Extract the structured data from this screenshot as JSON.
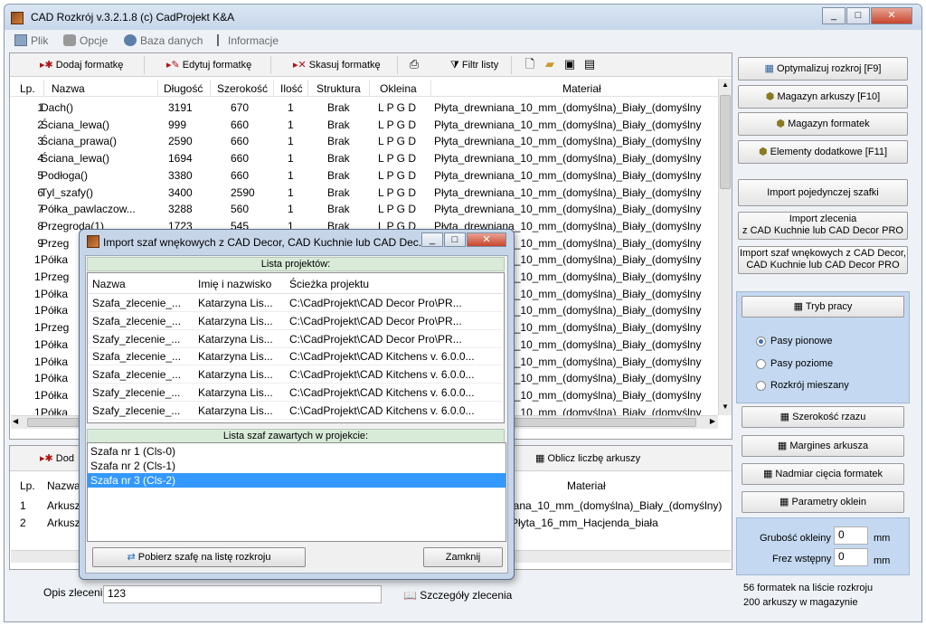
{
  "window": {
    "title": "CAD Rozkrój v.3.2.1.8  (c) CadProjekt K&A",
    "min": "_",
    "max": "□",
    "close": "✕"
  },
  "menu": [
    {
      "label": "Plik",
      "icon": "plik-icon"
    },
    {
      "label": "Opcje",
      "icon": "opcje-icon"
    },
    {
      "label": "Baza danych",
      "icon": "database-icon"
    },
    {
      "label": "Informacje",
      "icon": "info-icon"
    }
  ],
  "toolbar": {
    "add": "Dodaj formatkę",
    "edit": "Edytuj formatkę",
    "delete": "Skasuj formatkę",
    "filter": "Filtr listy"
  },
  "main_table": {
    "headers": [
      "Lp.",
      "Nazwa",
      "Długość",
      "Szerokość",
      "Ilość",
      "Struktura",
      "Okleina",
      "Materiał"
    ],
    "rows": [
      [
        "1",
        "Dach()",
        "3191",
        "670",
        "1",
        "Brak",
        "L P G D",
        "Płyta_drewniana_10_mm_(domyślna)_Biały_(domyślny"
      ],
      [
        "2",
        "Ściana_lewa()",
        "999",
        "660",
        "1",
        "Brak",
        "L P G D",
        "Płyta_drewniana_10_mm_(domyślna)_Biały_(domyślny"
      ],
      [
        "3",
        "Ściana_prawa()",
        "2590",
        "660",
        "1",
        "Brak",
        "L P G D",
        "Płyta_drewniana_10_mm_(domyślna)_Biały_(domyślny"
      ],
      [
        "4",
        "Ściana_lewa()",
        "1694",
        "660",
        "1",
        "Brak",
        "L P G D",
        "Płyta_drewniana_10_mm_(domyślna)_Biały_(domyślny"
      ],
      [
        "5",
        "Podłoga()",
        "3380",
        "660",
        "1",
        "Brak",
        "L P G D",
        "Płyta_drewniana_10_mm_(domyślna)_Biały_(domyślny"
      ],
      [
        "6",
        "Tyl_szafy()",
        "3400",
        "2590",
        "1",
        "Brak",
        "L P G D",
        "Płyta_drewniana_10_mm_(domyślna)_Biały_(domyślny"
      ],
      [
        "7",
        "Półka_pawlaczow...",
        "3288",
        "560",
        "1",
        "Brak",
        "L P G D",
        "Płyta_drewniana_10_mm_(domyślna)_Biały_(domyślny"
      ],
      [
        "8",
        "Przegroda(1)",
        "1723",
        "545",
        "1",
        "Brak",
        "L P G D",
        "Płyta_drewniana_10_mm_(domyślna)_Biały_(domyślny"
      ],
      [
        "9",
        "Przeg",
        "",
        "",
        "",
        "",
        "",
        "Płyta_drewniana_10_mm_(domyślna)_Biały_(domyślny"
      ],
      [
        "1.",
        "Półka",
        "",
        "",
        "",
        "",
        "",
        "Płyta_drewniana_10_mm_(domyślna)_Biały_(domyślny"
      ],
      [
        "1.",
        "Przeg",
        "",
        "",
        "",
        "",
        "",
        "Płyta_drewniana_10_mm_(domyślna)_Biały_(domyślny"
      ],
      [
        "1.",
        "Półka",
        "",
        "",
        "",
        "",
        "",
        "Płyta_drewniana_10_mm_(domyślna)_Biały_(domyślny"
      ],
      [
        "1.",
        "Półka",
        "",
        "",
        "",
        "",
        "",
        "Płyta_drewniana_10_mm_(domyślna)_Biały_(domyślny"
      ],
      [
        "1.",
        "Przeg",
        "",
        "",
        "",
        "",
        "",
        "Płyta_drewniana_10_mm_(domyślna)_Biały_(domyślny"
      ],
      [
        "1.",
        "Półka",
        "",
        "",
        "",
        "",
        "",
        "Płyta_drewniana_10_mm_(domyślna)_Biały_(domyślny"
      ],
      [
        "1.",
        "Półka",
        "",
        "",
        "",
        "",
        "",
        "Płyta_drewniana_10_mm_(domyślna)_Biały_(domyślny"
      ],
      [
        "1.",
        "Półka",
        "",
        "",
        "",
        "",
        "",
        "Płyta_drewniana_10_mm_(domyślna)_Biały_(domyślny"
      ],
      [
        "1.",
        "Półka",
        "",
        "",
        "",
        "",
        "",
        "Płyta_drewniana_10_mm_(domyślna)_Biały_(domyślny"
      ],
      [
        "1.",
        "Półka",
        "",
        "",
        "",
        "",
        "",
        "Płyta_drewniana_10_mm_(domyślna)_Biały_(domyślny"
      ]
    ]
  },
  "bottom_panel": {
    "add_btn": "Dod",
    "count_btn": "Oblicz liczbę arkuszy",
    "headers": [
      "Lp.",
      "Nazwa",
      "Materiał"
    ],
    "rows": [
      [
        "1",
        "Arkusz",
        "iana_10_mm_(domyślna)_Biały_(domyślny)"
      ],
      [
        "2",
        "Arkusz",
        "Płyta_16_mm_Hacjenda_biała"
      ]
    ]
  },
  "order": {
    "label": "Opis zlecenia",
    "value": "123",
    "details_btn": "Szczegóły zlecenia"
  },
  "right": {
    "optimize": "Optymalizuj rozkroj [F9]",
    "sheets": "Magazyn arkuszy [F10]",
    "formats": "Magazyn formatek",
    "extras": "Elementy dodatkowe [F11]",
    "import_single": "Import pojedynczej szafki",
    "import_order_1": "Import zlecenia",
    "import_order_2": "z CAD Kuchnie lub CAD Decor PRO",
    "import_wardrobe_1": "Import szaf wnękowych z CAD Decor,",
    "import_wardrobe_2": "CAD Kuchnie lub CAD Decor PRO",
    "mode": "Tryb pracy",
    "radio_vertical": "Pasy pionowe",
    "radio_horizontal": "Pasy poziome",
    "radio_mixed": "Rozkrój mieszany",
    "cut_width": "Szerokość rzazu",
    "sheet_margin": "Margines arkusza",
    "cut_excess": "Nadmiar cięcia formatek",
    "edge_params": "Parametry oklein",
    "edge_thickness_label": "Grubość okleiny",
    "edge_thickness_value": "0",
    "pre_mill_label": "Frez wstępny",
    "pre_mill_value": "0",
    "unit": "mm",
    "status_1": "56 formatek na liście rozkroju",
    "status_2": "200 arkuszy w magazynie"
  },
  "dialog": {
    "title": "Import szaf wnękowych z CAD Decor, CAD Kuchnie lub CAD Dec...",
    "projects_header": "Lista projektów:",
    "cols": [
      "Nazwa",
      "Imię i nazwisko",
      "Ścieżka projektu"
    ],
    "projects": [
      [
        "Szafa_zlecenie_...",
        "Katarzyna Lis...",
        "C:\\CadProjekt\\CAD Decor Pro\\PR..."
      ],
      [
        "Szafa_zlecenie_...",
        "Katarzyna Lis...",
        "C:\\CadProjekt\\CAD Decor Pro\\PR..."
      ],
      [
        "Szafy_zlecenie_...",
        "Katarzyna Lis...",
        "C:\\CadProjekt\\CAD Decor Pro\\PR..."
      ],
      [
        "Szafa_zlecenie_...",
        "Katarzyna Lis...",
        "C:\\CadProjekt\\CAD Kitchens v. 6.0.0..."
      ],
      [
        "Szafa_zlecenie_...",
        "Katarzyna Lis...",
        "C:\\CadProjekt\\CAD Kitchens v. 6.0.0..."
      ],
      [
        "Szafy_zlecenie_...",
        "Katarzyna Lis...",
        "C:\\CadProjekt\\CAD Kitchens v. 6.0.0..."
      ],
      [
        "Szafy_zlecenie_...",
        "Katarzyna Lis...",
        "C:\\CadProjekt\\CAD Kitchens v. 6.0.0..."
      ]
    ],
    "wardrobes_header": "Lista szaf zawartych w projekcie:",
    "wardrobes": [
      "Szafa nr 1 (Cls-0)",
      "Szafa nr 2 (Cls-1)",
      "Szafa nr 3 (Cls-2)"
    ],
    "fetch_btn": "Pobierz szafę na listę rozkroju",
    "close_btn": "Zamknij"
  },
  "colors": {
    "selection": "#3399ff",
    "accent_blue": "#c4d9f1",
    "title_bar": "#c6d6ea"
  }
}
